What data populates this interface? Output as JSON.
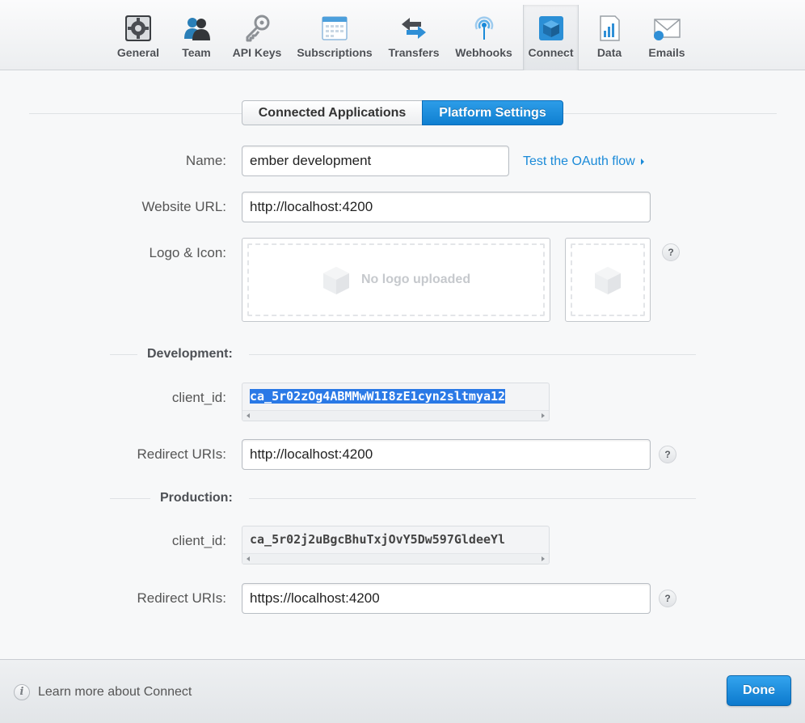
{
  "nav": {
    "items": [
      {
        "label": "General",
        "icon": "gear-icon"
      },
      {
        "label": "Team",
        "icon": "team-icon"
      },
      {
        "label": "API Keys",
        "icon": "key-icon"
      },
      {
        "label": "Subscriptions",
        "icon": "calendar-icon"
      },
      {
        "label": "Transfers",
        "icon": "transfer-arrows-icon"
      },
      {
        "label": "Webhooks",
        "icon": "broadcast-icon"
      },
      {
        "label": "Connect",
        "icon": "cube-icon"
      },
      {
        "label": "Data",
        "icon": "chart-document-icon"
      },
      {
        "label": "Emails",
        "icon": "envelope-icon"
      }
    ],
    "active": "Connect"
  },
  "tabs": {
    "connected_apps": "Connected Applications",
    "platform_settings": "Platform Settings"
  },
  "form": {
    "name_label": "Name:",
    "name_value": "ember development",
    "test_oauth_link": "Test the OAuth flow",
    "website_label": "Website URL:",
    "website_value": "http://localhost:4200",
    "logo_label": "Logo & Icon:",
    "no_logo_text": "No logo uploaded",
    "help_symbol": "?"
  },
  "development": {
    "title": "Development:",
    "client_id_label": "client_id:",
    "client_id_value": "ca_5r02zOg4ABMMwW1I8zE1cyn2sltmya12",
    "redirect_label": "Redirect URIs:",
    "redirect_value": "http://localhost:4200"
  },
  "production": {
    "title": "Production:",
    "client_id_label": "client_id:",
    "client_id_value": "ca_5r02j2uBgcBhuTxjOvY5Dw597GldeeYl",
    "redirect_label": "Redirect URIs:",
    "redirect_value": "https://localhost:4200"
  },
  "footer": {
    "info_symbol": "i",
    "learn_more": "Learn more about Connect",
    "done_button": "Done"
  },
  "colors": {
    "accent": "#1a8ad8",
    "primary_button": "#0f7fd1"
  }
}
